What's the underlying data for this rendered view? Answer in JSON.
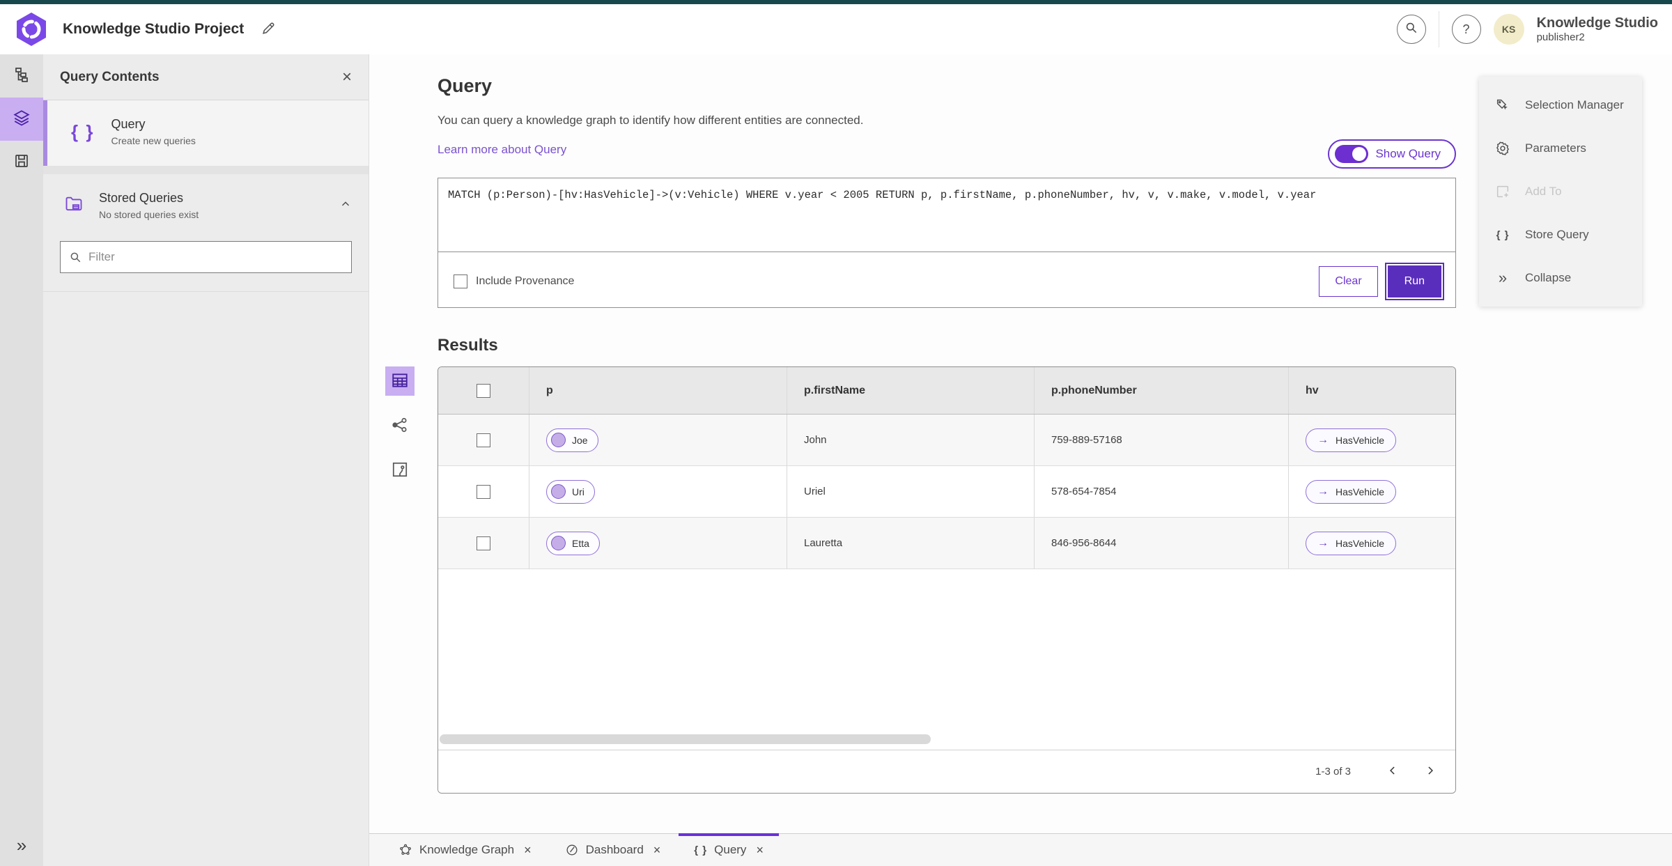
{
  "header": {
    "app_title": "Knowledge Studio Project",
    "product_name": "Knowledge Studio",
    "username": "publisher2",
    "avatar_initials": "KS"
  },
  "icons": {
    "close": "×",
    "help": "?",
    "collapse": "»",
    "braces": "{ }",
    "arrow_right": "→"
  },
  "query_contents": {
    "title": "Query Contents",
    "query_item": {
      "title": "Query",
      "subtitle": "Create new queries"
    },
    "stored_queries": {
      "title": "Stored Queries",
      "subtitle": "No stored queries exist"
    },
    "filter_placeholder": "Filter"
  },
  "query_section": {
    "title": "Query",
    "description": "You can query a knowledge graph to identify how different entities are connected.",
    "learn_more_link": "Learn more about Query",
    "show_query_label": "Show Query",
    "query_text": "MATCH (p:Person)-[hv:HasVehicle]->(v:Vehicle) WHERE v.year < 2005 RETURN p, p.firstName, p.phoneNumber, hv, v, v.make, v.model, v.year",
    "include_provenance_label": "Include Provenance",
    "clear_button": "Clear",
    "run_button": "Run"
  },
  "results": {
    "title": "Results",
    "columns": [
      "p",
      "p.firstName",
      "p.phoneNumber",
      "hv"
    ],
    "rows": [
      {
        "p": "Joe",
        "firstName": "John",
        "phoneNumber": "759-889-57168",
        "hv": "HasVehicle"
      },
      {
        "p": "Uri",
        "firstName": "Uriel",
        "phoneNumber": "578-654-7854",
        "hv": "HasVehicle"
      },
      {
        "p": "Etta",
        "firstName": "Lauretta",
        "phoneNumber": "846-956-8644",
        "hv": "HasVehicle"
      }
    ],
    "pagination": "1-3 of 3"
  },
  "context_menu": {
    "items": [
      {
        "label": "Selection Manager"
      },
      {
        "label": "Parameters"
      },
      {
        "label": "Add To"
      },
      {
        "label": "Store Query"
      },
      {
        "label": "Collapse"
      }
    ]
  },
  "tabs": [
    {
      "label": "Knowledge Graph"
    },
    {
      "label": "Dashboard"
    },
    {
      "label": "Query"
    }
  ],
  "colors": {
    "primary_purple": "#5a2ebc",
    "selected_purple_bg": "#c9aef2",
    "link_purple": "#7a52cf",
    "top_accent_teal": "#17494c"
  }
}
